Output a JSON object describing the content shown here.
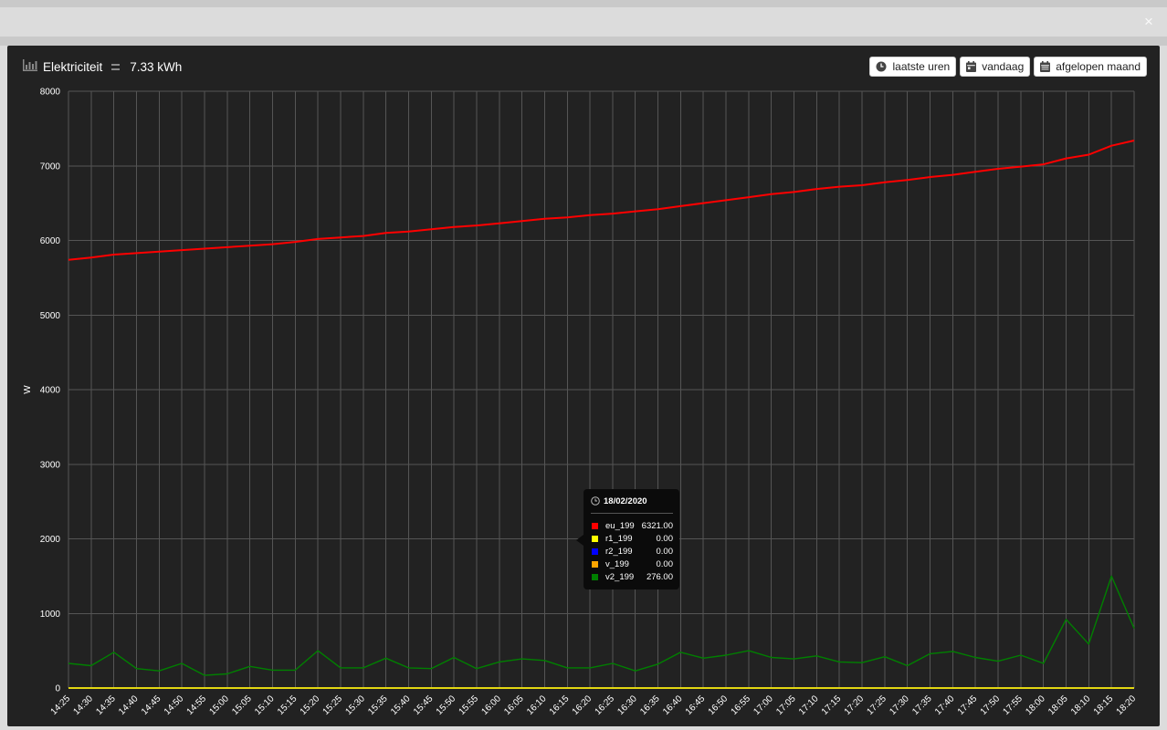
{
  "modal": {
    "close_label": "×"
  },
  "title": {
    "icon": "bar-chart-icon",
    "label": "Elektriciteit",
    "total": "7.33 kWh"
  },
  "buttons": [
    {
      "icon": "clock-icon",
      "label": "laatste uren"
    },
    {
      "icon": "calendar-icon",
      "label": "vandaag"
    },
    {
      "icon": "calendar-icon",
      "label": "afgelopen maand"
    }
  ],
  "tooltip": {
    "icon": "clock-icon",
    "date": "18/02/2020",
    "rows": [
      {
        "name": "eu_199",
        "value": "6321.00",
        "color": "#ff0000"
      },
      {
        "name": "r1_199",
        "value": "0.00",
        "color": "#ffff00"
      },
      {
        "name": "r2_199",
        "value": "0.00",
        "color": "#0000ff"
      },
      {
        "name": "v_199",
        "value": "0.00",
        "color": "#ffa500"
      },
      {
        "name": "v2_199",
        "value": "276.00",
        "color": "#008000"
      }
    ]
  },
  "chart_data": {
    "type": "line",
    "ylabel": "W",
    "ylim": [
      0,
      8000
    ],
    "yticks": [
      0,
      1000,
      2000,
      3000,
      4000,
      5000,
      6000,
      7000,
      8000
    ],
    "grid": true,
    "x": [
      "14:25",
      "14:30",
      "14:35",
      "14:40",
      "14:45",
      "14:50",
      "14:55",
      "15:00",
      "15:05",
      "15:10",
      "15:15",
      "15:20",
      "15:25",
      "15:30",
      "15:35",
      "15:40",
      "15:45",
      "15:50",
      "15:55",
      "16:00",
      "16:05",
      "16:10",
      "16:15",
      "16:20",
      "16:25",
      "16:30",
      "16:35",
      "16:40",
      "16:45",
      "16:50",
      "16:55",
      "17:00",
      "17:05",
      "17:10",
      "17:15",
      "17:20",
      "17:25",
      "17:30",
      "17:35",
      "17:40",
      "17:45",
      "17:50",
      "17:55",
      "18:00",
      "18:05",
      "18:10",
      "18:15",
      "18:20"
    ],
    "series": [
      {
        "name": "eu_199",
        "color": "#ff0000",
        "values": [
          5740,
          5770,
          5810,
          5830,
          5850,
          5870,
          5890,
          5910,
          5930,
          5950,
          5980,
          6020,
          6040,
          6060,
          6100,
          6120,
          6150,
          6180,
          6200,
          6230,
          6260,
          6290,
          6310,
          6340,
          6360,
          6390,
          6420,
          6460,
          6500,
          6540,
          6580,
          6620,
          6650,
          6690,
          6720,
          6740,
          6780,
          6810,
          6850,
          6880,
          6920,
          6960,
          6990,
          7020,
          7100,
          7150,
          7270,
          7340
        ]
      },
      {
        "name": "r1_199",
        "color": "#ffff00",
        "values": [
          0,
          0,
          0,
          0,
          0,
          0,
          0,
          0,
          0,
          0,
          0,
          0,
          0,
          0,
          0,
          0,
          0,
          0,
          0,
          0,
          0,
          0,
          0,
          0,
          0,
          0,
          0,
          0,
          0,
          0,
          0,
          0,
          0,
          0,
          0,
          0,
          0,
          0,
          0,
          0,
          0,
          0,
          0,
          0,
          0,
          0,
          0,
          0
        ]
      },
      {
        "name": "r2_199",
        "color": "#0000ff",
        "values": [
          0,
          0,
          0,
          0,
          0,
          0,
          0,
          0,
          0,
          0,
          0,
          0,
          0,
          0,
          0,
          0,
          0,
          0,
          0,
          0,
          0,
          0,
          0,
          0,
          0,
          0,
          0,
          0,
          0,
          0,
          0,
          0,
          0,
          0,
          0,
          0,
          0,
          0,
          0,
          0,
          0,
          0,
          0,
          0,
          0,
          0,
          0,
          0
        ]
      },
      {
        "name": "v_199",
        "color": "#ffa500",
        "values": [
          0,
          0,
          0,
          0,
          0,
          0,
          0,
          0,
          0,
          0,
          0,
          0,
          0,
          0,
          0,
          0,
          0,
          0,
          0,
          0,
          0,
          0,
          0,
          0,
          0,
          0,
          0,
          0,
          0,
          0,
          0,
          0,
          0,
          0,
          0,
          0,
          0,
          0,
          0,
          0,
          0,
          0,
          0,
          0,
          0,
          0,
          0,
          0
        ]
      },
      {
        "name": "v2_199",
        "color": "#008000",
        "values": [
          330,
          300,
          480,
          260,
          230,
          330,
          170,
          190,
          290,
          240,
          240,
          500,
          270,
          270,
          400,
          270,
          260,
          410,
          260,
          350,
          390,
          370,
          270,
          270,
          330,
          230,
          320,
          480,
          400,
          440,
          500,
          410,
          390,
          430,
          350,
          340,
          420,
          300,
          460,
          490,
          410,
          360,
          440,
          330,
          920,
          590,
          1500,
          800
        ]
      }
    ]
  }
}
